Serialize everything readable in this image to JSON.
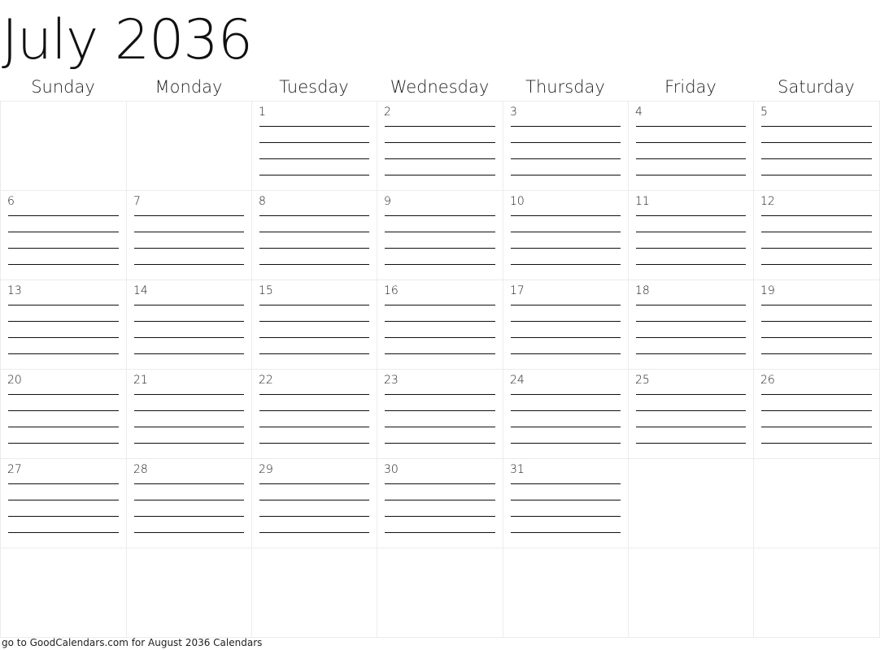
{
  "title": "July 2036",
  "weekdays": [
    "Sunday",
    "Monday",
    "Tuesday",
    "Wednesday",
    "Thursday",
    "Friday",
    "Saturday"
  ],
  "weeks": [
    [
      "",
      "",
      "1",
      "2",
      "3",
      "4",
      "5"
    ],
    [
      "6",
      "7",
      "8",
      "9",
      "10",
      "11",
      "12"
    ],
    [
      "13",
      "14",
      "15",
      "16",
      "17",
      "18",
      "19"
    ],
    [
      "20",
      "21",
      "22",
      "23",
      "24",
      "25",
      "26"
    ],
    [
      "27",
      "28",
      "29",
      "30",
      "31",
      "",
      ""
    ],
    [
      "",
      "",
      "",
      "",
      "",
      "",
      ""
    ]
  ],
  "lines_per_day": 4,
  "footer": "go to GoodCalendars.com for August 2036 Calendars"
}
